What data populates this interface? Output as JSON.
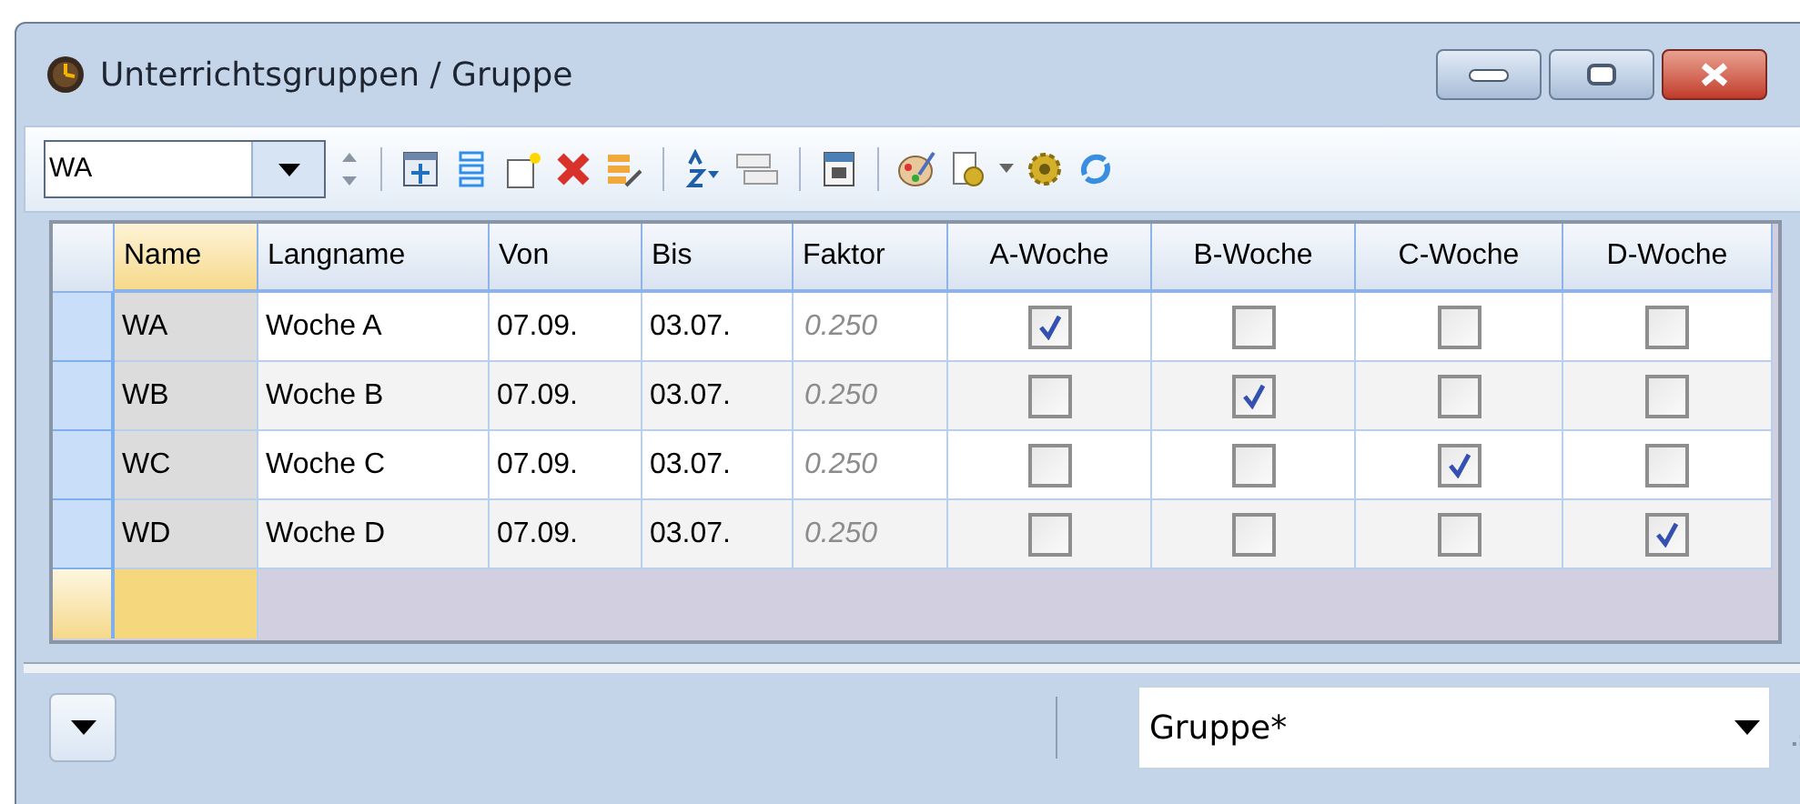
{
  "window": {
    "title": "Unterrichtsgruppen / Gruppe"
  },
  "toolbar": {
    "selector_value": "WA"
  },
  "table": {
    "columns": [
      "Name",
      "Langname",
      "Von",
      "Bis",
      "Faktor",
      "A-Woche",
      "B-Woche",
      "C-Woche",
      "D-Woche"
    ],
    "rows": [
      {
        "name": "WA",
        "langname": "Woche A",
        "von": "07.09.",
        "bis": "03.07.",
        "faktor": "0.250",
        "weeks": [
          true,
          false,
          false,
          false
        ]
      },
      {
        "name": "WB",
        "langname": "Woche B",
        "von": "07.09.",
        "bis": "03.07.",
        "faktor": "0.250",
        "weeks": [
          false,
          true,
          false,
          false
        ]
      },
      {
        "name": "WC",
        "langname": "Woche C",
        "von": "07.09.",
        "bis": "03.07.",
        "faktor": "0.250",
        "weeks": [
          false,
          false,
          true,
          false
        ]
      },
      {
        "name": "WD",
        "langname": "Woche D",
        "von": "07.09.",
        "bis": "03.07.",
        "faktor": "0.250",
        "weeks": [
          false,
          false,
          false,
          true
        ]
      }
    ]
  },
  "status_bar": {
    "view_selector": "Gruppe*"
  }
}
